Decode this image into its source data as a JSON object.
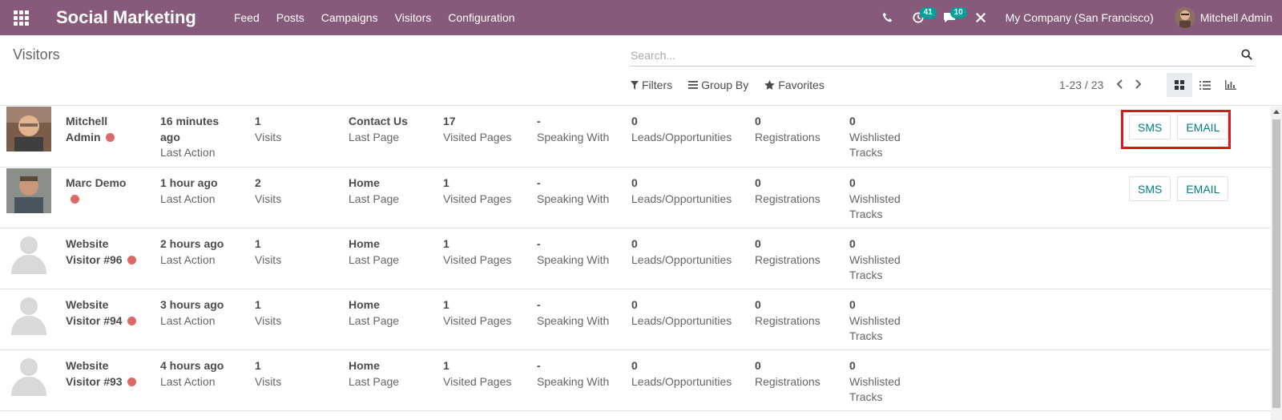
{
  "app": {
    "brand": "Social Marketing"
  },
  "menu": [
    "Feed",
    "Posts",
    "Campaigns",
    "Visitors",
    "Configuration"
  ],
  "systray": {
    "activity_count": "41",
    "message_count": "10",
    "company": "My Company (San Francisco)",
    "user": "Mitchell Admin"
  },
  "breadcrumb": "Visitors",
  "search": {
    "placeholder": "Search..."
  },
  "filters": {
    "filters": "Filters",
    "group_by": "Group By",
    "favorites": "Favorites"
  },
  "pager": {
    "text": "1-23 / 23"
  },
  "buttons": {
    "sms": "SMS",
    "email": "EMAIL"
  },
  "labels": {
    "last_action": "Last Action",
    "visits": "Visits",
    "last_page": "Last Page",
    "visited_pages": "Visited Pages",
    "speaking_with": "Speaking With",
    "leads": "Leads/Opportunities",
    "registrations": "Registrations",
    "wishlisted": "Wishlisted Tracks"
  },
  "rows": [
    {
      "name": "Mitchell Admin",
      "time": "16 minutes ago",
      "visits": "1",
      "last_page": "Contact Us",
      "pages": "17",
      "speaking": "-",
      "leads": "0",
      "registrations": "0",
      "wishlisted": "0",
      "avatar": "photo-mitchell"
    },
    {
      "name": "Marc Demo",
      "time": "1 hour ago",
      "visits": "2",
      "last_page": "Home",
      "pages": "1",
      "speaking": "-",
      "leads": "0",
      "registrations": "0",
      "wishlisted": "0",
      "avatar": "photo-marc"
    },
    {
      "name": "Website Visitor #96",
      "time": "2 hours ago",
      "visits": "1",
      "last_page": "Home",
      "pages": "1",
      "speaking": "-",
      "leads": "0",
      "registrations": "0",
      "wishlisted": "0",
      "avatar": "placeholder"
    },
    {
      "name": "Website Visitor #94",
      "time": "3 hours ago",
      "visits": "1",
      "last_page": "Home",
      "pages": "1",
      "speaking": "-",
      "leads": "0",
      "registrations": "0",
      "wishlisted": "0",
      "avatar": "placeholder"
    },
    {
      "name": "Website Visitor #93",
      "time": "4 hours ago",
      "visits": "1",
      "last_page": "Home",
      "pages": "1",
      "speaking": "-",
      "leads": "0",
      "registrations": "0",
      "wishlisted": "0",
      "avatar": "placeholder"
    }
  ]
}
